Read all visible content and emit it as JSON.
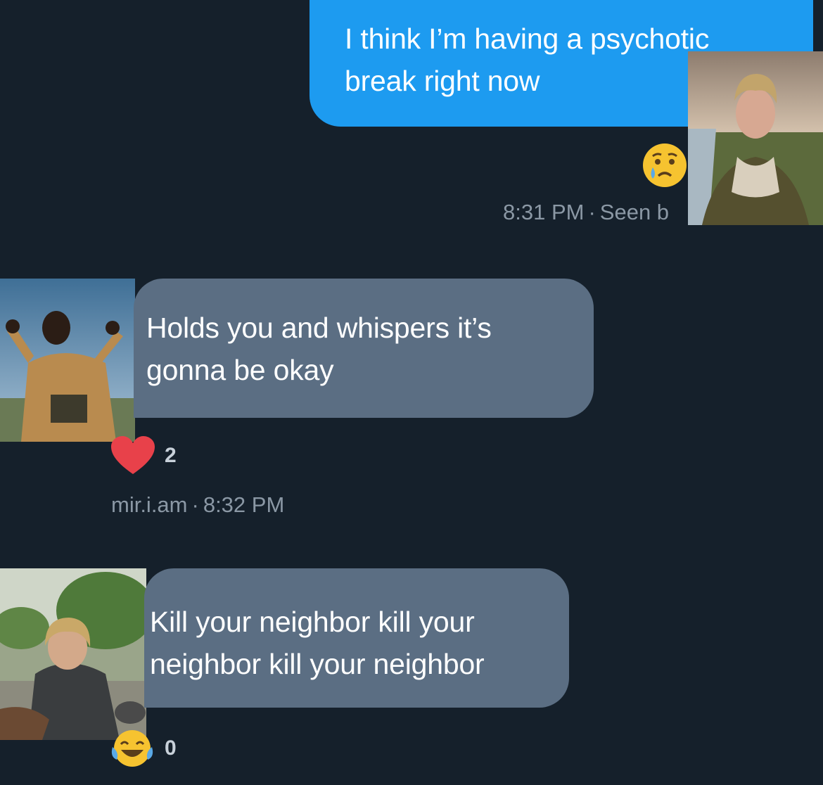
{
  "messages": [
    {
      "direction": "outgoing",
      "lines": [
        "I think I’m having a psychotic",
        "break right now"
      ],
      "reaction": "crying-face-emoji",
      "time": "8:31 PM",
      "status": "Seen b"
    },
    {
      "direction": "incoming",
      "lines": [
        "Holds you and whispers it’s",
        "gonna be okay"
      ],
      "reaction": "red-heart-emoji",
      "reaction_count": "2",
      "sender": "mir.i.am",
      "time": "8:32 PM"
    },
    {
      "direction": "incoming",
      "lines": [
        "Kill your neighbor kill your",
        "neighbor kill your neighbor"
      ],
      "reaction": "laughing-tears-emoji",
      "reaction_count": "0"
    }
  ],
  "colors": {
    "background": "#15202b",
    "outgoing_bubble": "#1d9bf0",
    "incoming_bubble": "#5b6e83",
    "meta_text": "#8b98a5"
  }
}
